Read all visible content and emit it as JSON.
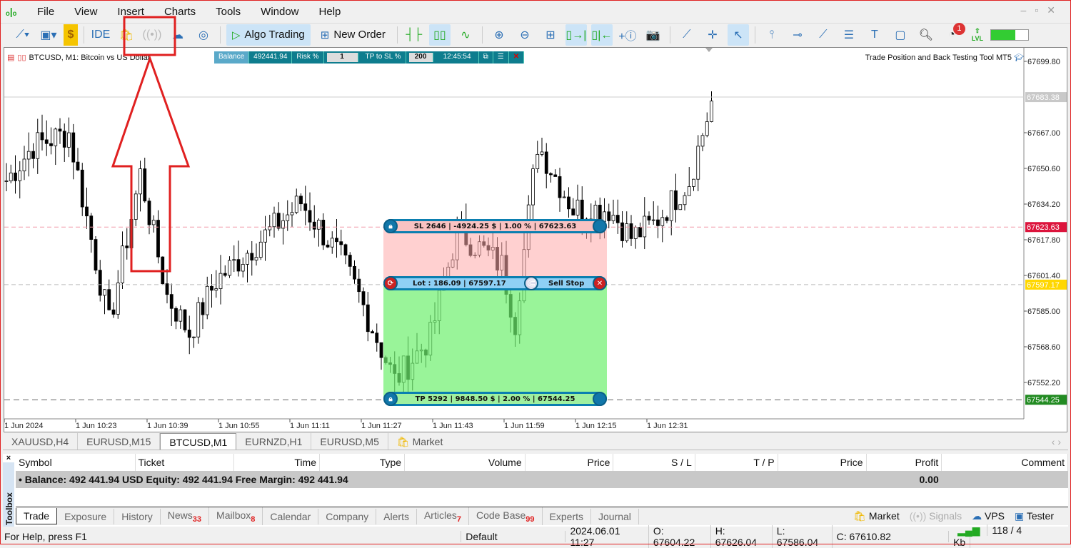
{
  "menu": [
    "File",
    "View",
    "Insert",
    "Charts",
    "Tools",
    "Window",
    "Help"
  ],
  "toolbar": {
    "algo": "Algo Trading",
    "order": "New Order",
    "ide": "IDE",
    "notif_count": "1",
    "lvl": "LVL"
  },
  "chart": {
    "title": "BTCUSD, M1:  Bitcoin vs US Dollar",
    "indicator": "Trade Position and Back Testing Tool MT5",
    "panel": {
      "balance_label": "Balance",
      "balance": "492441.94",
      "risk_label": "Risk %",
      "risk": "1",
      "tp_label": "TP to SL %",
      "tp": "200",
      "time": "12:45:54"
    },
    "sl_bar": "SL 2646  |  -4924.25 $  |  1.00 %  |  67623.63",
    "lot_bar": "Lot :  186.09   |   67597.17",
    "order_type": "Sell Stop",
    "tp_bar": "TP 5292  |  9848.50 $  |  2.00 %  |  67544.25"
  },
  "chart_data": {
    "type": "candlestick",
    "symbol": "BTCUSD",
    "timeframe": "M1",
    "y_ticks": [
      "67699.80",
      "67667.00",
      "67650.60",
      "67634.20",
      "67617.80",
      "67601.40",
      "67585.00",
      "67568.60",
      "67552.20"
    ],
    "y_tick_values": [
      67699.8,
      67667.0,
      67650.6,
      67634.2,
      67617.8,
      67601.4,
      67585.0,
      67568.6,
      67552.2
    ],
    "x_ticks": [
      "1 Jun 2024",
      "1 Jun 10:23",
      "1 Jun 10:39",
      "1 Jun 10:55",
      "1 Jun 11:11",
      "1 Jun 11:27",
      "1 Jun 11:43",
      "1 Jun 11:59",
      "1 Jun 12:15",
      "1 Jun 12:31"
    ],
    "levels": [
      {
        "label": "67683.38",
        "price": 67683.38,
        "color": "#c8c8c8"
      },
      {
        "label": "67623.63",
        "price": 67623.63,
        "color": "#dc143c"
      },
      {
        "label": "67597.17",
        "price": 67597.17,
        "color": "#ffd700"
      },
      {
        "label": "67544.25",
        "price": 67544.25,
        "color": "#228b22"
      }
    ],
    "anchor_closes": [
      [
        0,
        67645
      ],
      [
        6,
        67661
      ],
      [
        14,
        67667
      ],
      [
        23,
        67579
      ],
      [
        30,
        67648
      ],
      [
        36,
        67592
      ],
      [
        41,
        67575
      ],
      [
        47,
        67599
      ],
      [
        66,
        67635
      ],
      [
        75,
        67609
      ],
      [
        79,
        67592
      ],
      [
        87,
        67553
      ],
      [
        95,
        67573
      ],
      [
        101,
        67622
      ],
      [
        111,
        67606
      ],
      [
        114,
        67580
      ],
      [
        119,
        67662
      ],
      [
        127,
        67632
      ],
      [
        135,
        67632
      ],
      [
        140,
        67619
      ],
      [
        145,
        67625
      ],
      [
        153,
        67645
      ],
      [
        158,
        67681
      ]
    ]
  },
  "tabs": [
    "XAUUSD,H4",
    "EURUSD,M15",
    "BTCUSD,M1",
    "EURNZD,H1",
    "EURUSD,M5",
    "Market"
  ],
  "toolbox": {
    "label": "Toolbox",
    "columns": [
      "Symbol",
      "Ticket",
      "Time",
      "Type",
      "Volume",
      "Price",
      "S / L",
      "T / P",
      "Price",
      "Profit",
      "Comment"
    ],
    "balance_row": "Balance: 492 441.94 USD  Equity: 492 441.94  Free Margin: 492 441.94",
    "profit": "0.00",
    "tabs": [
      {
        "l": "Trade"
      },
      {
        "l": "Exposure"
      },
      {
        "l": "History"
      },
      {
        "l": "News",
        "n": "33"
      },
      {
        "l": "Mailbox",
        "n": "8"
      },
      {
        "l": "Calendar"
      },
      {
        "l": "Company"
      },
      {
        "l": "Alerts"
      },
      {
        "l": "Articles",
        "n": "7"
      },
      {
        "l": "Code Base",
        "n": "99"
      },
      {
        "l": "Experts"
      },
      {
        "l": "Journal"
      }
    ],
    "right": [
      "Market",
      "Signals",
      "VPS",
      "Tester"
    ]
  },
  "status": {
    "help": "For Help, press F1",
    "profile": "Default",
    "time": "2024.06.01 11:27",
    "o": "O: 67604.22",
    "h": "H: 67626.04",
    "l": "L: 67586.04",
    "c": "C: 67610.82",
    "net": "118 / 4 Kb"
  }
}
